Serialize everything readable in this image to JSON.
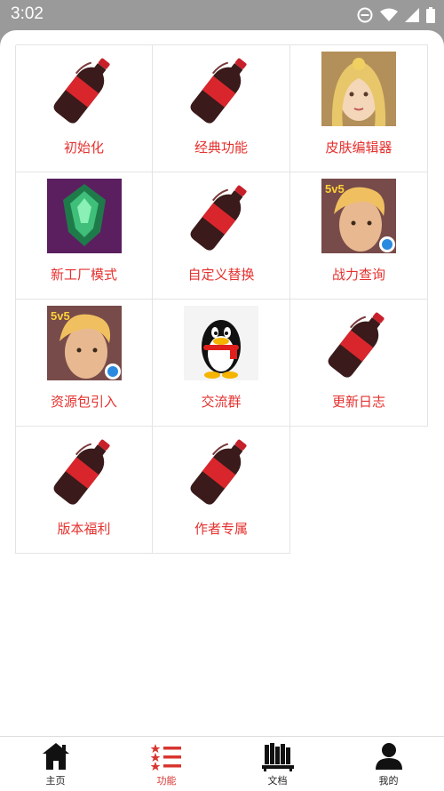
{
  "status_bar": {
    "time": "3:02"
  },
  "grid": {
    "items": [
      {
        "label": "初始化",
        "icon": "cola-bottle-icon"
      },
      {
        "label": "经典功能",
        "icon": "cola-bottle-icon"
      },
      {
        "label": "皮肤编辑器",
        "icon": "hero-portrait-icon"
      },
      {
        "label": "新工厂模式",
        "icon": "green-gem-icon"
      },
      {
        "label": "自定义替换",
        "icon": "cola-bottle-icon"
      },
      {
        "label": "战力查询",
        "icon": "game-5v5-icon"
      },
      {
        "label": "资源包引入",
        "icon": "game-5v5-icon"
      },
      {
        "label": "交流群",
        "icon": "qq-penguin-icon"
      },
      {
        "label": "更新日志",
        "icon": "cola-bottle-icon"
      },
      {
        "label": "版本福利",
        "icon": "cola-bottle-icon"
      },
      {
        "label": "作者专属",
        "icon": "cola-bottle-icon"
      }
    ]
  },
  "nav": {
    "items": [
      {
        "label": "主页",
        "icon": "home-icon"
      },
      {
        "label": "功能",
        "icon": "list-icon"
      },
      {
        "label": "文档",
        "icon": "books-icon"
      },
      {
        "label": "我的",
        "icon": "user-icon"
      }
    ],
    "active_index": 1
  },
  "colors": {
    "accent": "#e4312e",
    "statusbar": "#9a9a9a"
  }
}
